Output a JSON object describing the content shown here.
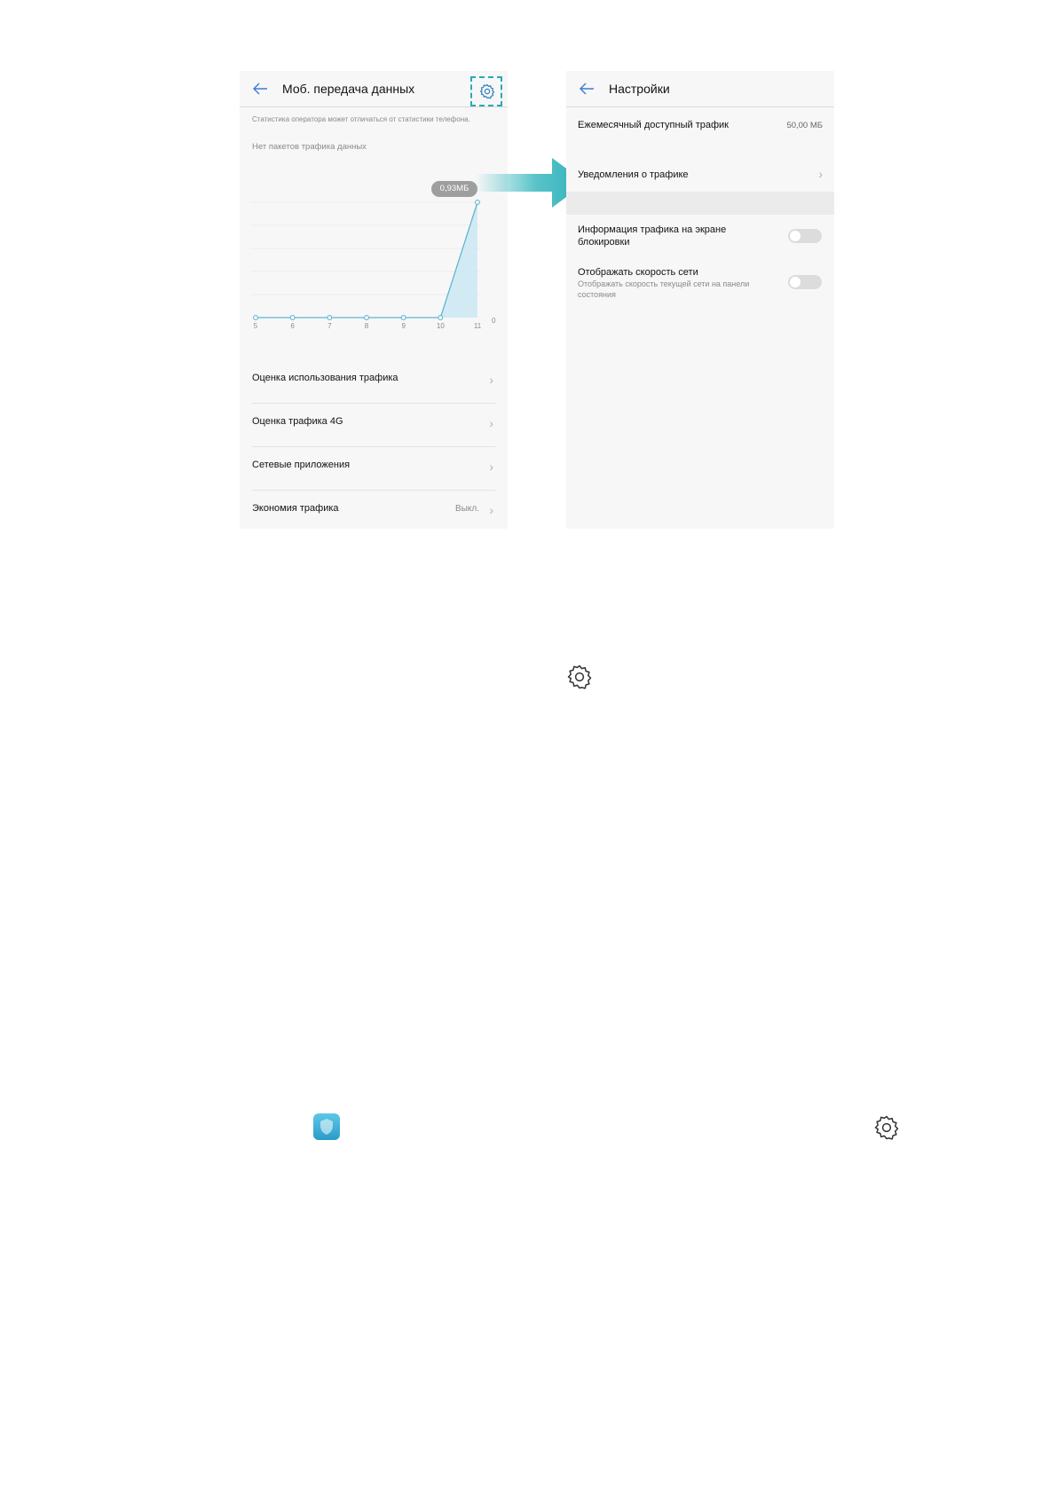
{
  "left_screen": {
    "title": "Моб. передача данных",
    "operator_note": "Статистика оператора может отличаться от статистики телефона.",
    "no_packages": "Нет пакетов трафика данных",
    "chart_badge": "0,93МБ",
    "menu": [
      {
        "label": "Оценка использования трафика",
        "value": ""
      },
      {
        "label": "Оценка трафика 4G",
        "value": ""
      },
      {
        "label": "Сетевые приложения",
        "value": ""
      },
      {
        "label": "Экономия трафика",
        "value": "Выкл."
      }
    ]
  },
  "right_screen": {
    "title": "Настройки",
    "monthly_label": "Ежемесячный доступный трафик",
    "monthly_value": "50,00 МБ",
    "notifications_label": "Уведомления о трафике",
    "lockscreen_label": "Информация трафика на экране блокировки",
    "lockscreen_enabled": false,
    "speed_label": "Отображать скорость сети",
    "speed_sub": "Отображать скорость текущей сети на панели состояния",
    "speed_enabled": false
  },
  "chart_data": {
    "type": "area",
    "x": [
      "5",
      "6",
      "7",
      "8",
      "9",
      "10",
      "11"
    ],
    "values": [
      0,
      0,
      0,
      0,
      0,
      0,
      0.93
    ],
    "y_tick_label": "0",
    "peak_label": "0,93МБ",
    "unit": "МБ",
    "grid": true,
    "accent_color": "#5fb6d3"
  },
  "icons": [
    "back-arrow-icon",
    "gear-icon",
    "chevron-right-icon",
    "teal-arrow-icon",
    "phone-manager-icon"
  ],
  "colors": {
    "accent": "#2aa9b6",
    "arrow": "#3bb8c0",
    "screen_bg": "#f7f7f7"
  }
}
